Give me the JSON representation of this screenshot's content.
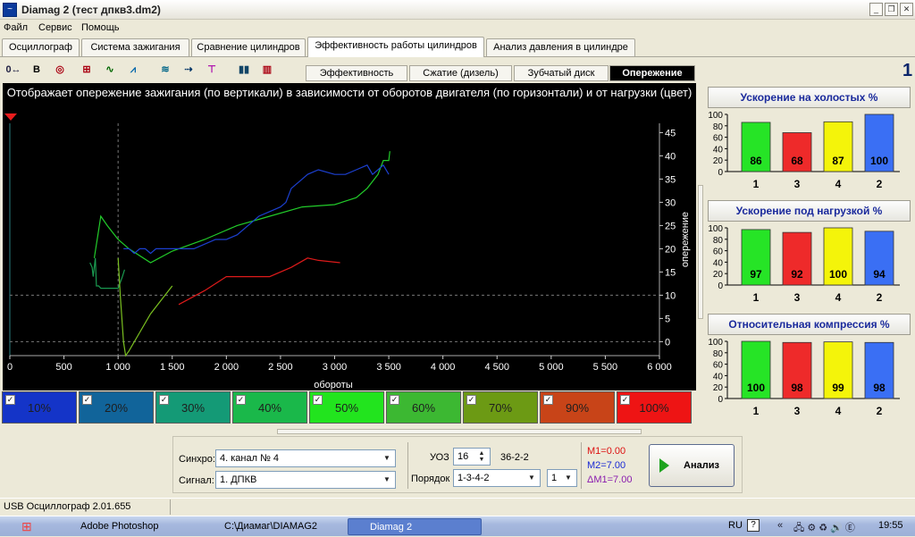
{
  "window": {
    "title": "Diamag 2 (тест  дпкв3.dm2)"
  },
  "menu": [
    "Файл",
    "Сервис",
    "Помощь"
  ],
  "tabs": [
    "Осциллограф",
    "Система зажигания",
    "Сравнение цилиндров",
    "Эффективность работы цилиндров",
    "Анализ давления в цилиндре"
  ],
  "subtabs": [
    "Эффективность",
    "Сжатие (дизель)",
    "Зубчатый диск",
    "Опережение"
  ],
  "page_number": "1",
  "chart_description": "Отображает опережение зажигания (по вертикали) в зависимости от оборотов двигателя (по горизонтали) и от нагрузки (цвет)",
  "legend": [
    {
      "label": "10%",
      "color": "#1434c8"
    },
    {
      "label": "20%",
      "color": "#11649a"
    },
    {
      "label": "30%",
      "color": "#149a76"
    },
    {
      "label": "40%",
      "color": "#1ab84a"
    },
    {
      "label": "50%",
      "color": "#22e41e"
    },
    {
      "label": "60%",
      "color": "#3cb832"
    },
    {
      "label": "70%",
      "color": "#6c9a14"
    },
    {
      "label": "90%",
      "color": "#c84418"
    },
    {
      "label": "100%",
      "color": "#ee1414"
    }
  ],
  "chart_data": [
    {
      "type": "line",
      "xlabel": "обороты",
      "ylabel": "опережение",
      "xlim": [
        0,
        6000
      ],
      "ylim": [
        -3,
        47
      ],
      "x_ticks": [
        "0",
        "500",
        "1 000",
        "1 500",
        "2 000",
        "2 500",
        "3 000",
        "3 500",
        "4 000",
        "4 500",
        "5 000",
        "5 500",
        "6 000"
      ],
      "y_ticks": [
        "0",
        "5",
        "10",
        "15",
        "20",
        "25",
        "30",
        "35",
        "40",
        "45"
      ],
      "grid": "dashed lines at y=0, y=10, x=1000",
      "series": [
        {
          "color": "#1a9a50",
          "points": [
            [
              740,
              17
            ],
            [
              760,
              16
            ],
            [
              770,
              14
            ],
            [
              790,
              18
            ],
            [
              800,
              12
            ],
            [
              820,
              12
            ],
            [
              840,
              11.5
            ],
            [
              1000,
              11.5
            ],
            [
              1040,
              14
            ],
            [
              1060,
              15.5
            ]
          ]
        },
        {
          "color": "#22cc2a",
          "points": [
            [
              780,
              18
            ],
            [
              820,
              24
            ],
            [
              840,
              27
            ],
            [
              900,
              25
            ],
            [
              1000,
              22
            ],
            [
              1100,
              20
            ],
            [
              1300,
              17
            ],
            [
              1500,
              19.5
            ],
            [
              1800,
              22
            ],
            [
              2100,
              25
            ],
            [
              2400,
              27
            ],
            [
              2700,
              29
            ],
            [
              3000,
              29.5
            ],
            [
              3200,
              31
            ],
            [
              3300,
              33
            ],
            [
              3400,
              36
            ],
            [
              3450,
              39
            ],
            [
              3500,
              39
            ],
            [
              3510,
              41
            ]
          ]
        },
        {
          "color": "#7ac020",
          "points": [
            [
              1000,
              18
            ],
            [
              1020,
              10
            ],
            [
              1050,
              0
            ],
            [
              1070,
              -3
            ],
            [
              1100,
              -2
            ],
            [
              1200,
              2
            ],
            [
              1300,
              6
            ],
            [
              1400,
              9
            ],
            [
              1500,
              12
            ]
          ]
        },
        {
          "color": "#1c40d0",
          "points": [
            [
              1050,
              20
            ],
            [
              1100,
              20
            ],
            [
              1150,
              19
            ],
            [
              1200,
              20
            ],
            [
              1250,
              20
            ],
            [
              1300,
              19
            ],
            [
              1350,
              20
            ],
            [
              1500,
              20
            ],
            [
              1700,
              20
            ],
            [
              1800,
              21
            ],
            [
              1900,
              22
            ],
            [
              2000,
              22
            ],
            [
              2100,
              23
            ],
            [
              2200,
              25
            ],
            [
              2300,
              27
            ],
            [
              2400,
              28
            ],
            [
              2500,
              29
            ],
            [
              2550,
              30
            ],
            [
              2600,
              33
            ],
            [
              2700,
              35
            ],
            [
              2750,
              36
            ],
            [
              2850,
              37
            ],
            [
              3000,
              36
            ],
            [
              3100,
              36
            ],
            [
              3200,
              37
            ],
            [
              3300,
              38
            ],
            [
              3350,
              36
            ],
            [
              3400,
              37
            ],
            [
              3450,
              38
            ],
            [
              3500,
              36
            ]
          ]
        },
        {
          "color": "#dd1a1a",
          "points": [
            [
              1560,
              8
            ],
            [
              1800,
              11
            ],
            [
              2000,
              14
            ],
            [
              2400,
              14
            ],
            [
              2600,
              16
            ],
            [
              2750,
              18
            ],
            [
              2850,
              17.5
            ],
            [
              3050,
              17
            ]
          ]
        }
      ]
    },
    {
      "type": "bar",
      "title": "Ускорение на холостых %",
      "categories": [
        "1",
        "3",
        "4",
        "2"
      ],
      "values": [
        86,
        68,
        87,
        100
      ],
      "colors": [
        "#26e426",
        "#ee2a2a",
        "#f4f40a",
        "#3a6ff4"
      ],
      "ylim": [
        0,
        100
      ]
    },
    {
      "type": "bar",
      "title": "Ускорение под нагрузкой %",
      "categories": [
        "1",
        "3",
        "4",
        "2"
      ],
      "values": [
        97,
        92,
        100,
        94
      ],
      "colors": [
        "#26e426",
        "#ee2a2a",
        "#f4f40a",
        "#3a6ff4"
      ],
      "ylim": [
        0,
        100
      ]
    },
    {
      "type": "bar",
      "title": "Относительная компрессия %",
      "categories": [
        "1",
        "3",
        "4",
        "2"
      ],
      "values": [
        100,
        98,
        99,
        98
      ],
      "colors": [
        "#26e426",
        "#ee2a2a",
        "#f4f40a",
        "#3a6ff4"
      ],
      "ylim": [
        0,
        100
      ]
    }
  ],
  "controls": {
    "sync_label": "Синхро:",
    "sync_value": "4.  канал № 4",
    "signal_label": "Сигнал:",
    "signal_value": "1.  ДПКВ",
    "uoz_label": "УОЗ",
    "uoz_value": "16",
    "teeth": "36-2-2",
    "order_label": "Порядок",
    "order_value": "1-3-4-2",
    "order_num": "1",
    "m1": "М1=0.00",
    "m2": "М2=7.00",
    "dm": "ΔМ1=7.00",
    "analyze": "Анализ"
  },
  "status": "USB Осциллограф  2.01.655",
  "taskbar": {
    "items": [
      "Adobe Photoshop",
      "C:\\Диамаг\\DIAMAG2",
      "Diamag 2"
    ],
    "lang": "RU",
    "clock": "19:55"
  }
}
